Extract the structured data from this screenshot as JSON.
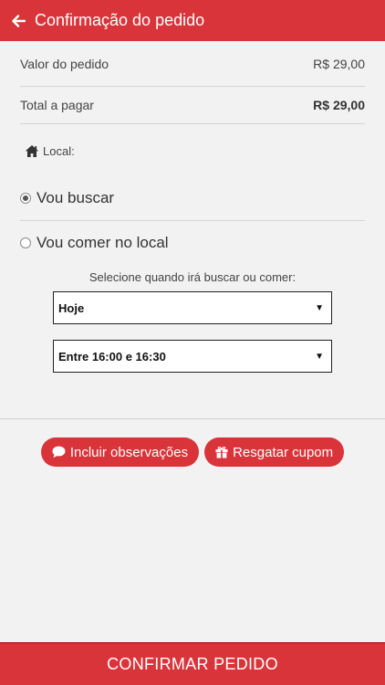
{
  "header": {
    "title": "Confirmação do pedido",
    "back_icon": "arrow-left-icon"
  },
  "summary": {
    "order_value_label": "Valor do pedido",
    "order_value": "R$ 29,00",
    "total_label": "Total a pagar",
    "total_value": "R$ 29,00"
  },
  "local": {
    "label": "Local:",
    "icon": "home-icon",
    "options": [
      {
        "label": "Vou buscar",
        "selected": true
      },
      {
        "label": "Vou comer no local",
        "selected": false
      }
    ]
  },
  "schedule": {
    "prompt": "Selecione quando irá buscar ou comer:",
    "day_selected": "Hoje",
    "time_selected": "Entre 16:00 e 16:30"
  },
  "actions": {
    "notes_label": "Incluir observações",
    "coupon_label": "Resgatar cupom"
  },
  "footer": {
    "confirm_label": "CONFIRMAR PEDIDO"
  },
  "colors": {
    "brand": "#d9343a",
    "background": "#f2f2f2"
  }
}
